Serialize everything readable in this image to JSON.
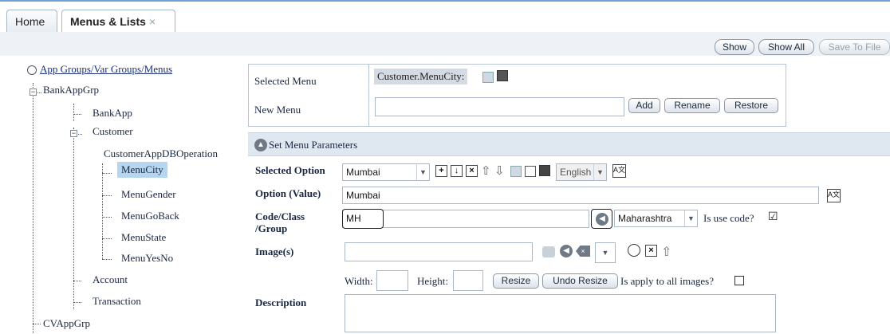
{
  "tabs": [
    {
      "label": "Home"
    },
    {
      "label": "Menus & Lists",
      "close": "×"
    }
  ],
  "toolbar": {
    "show": "Show",
    "show_all": "Show All",
    "save_to_file": "Save To File"
  },
  "tree": {
    "root": "App Groups/Var Groups/Menus",
    "bank_app_grp": "BankAppGrp",
    "bank_app": "BankApp",
    "customer": "Customer",
    "customer_db_op": "CustomerAppDBOperation",
    "menu_city": "MenuCity",
    "menu_gender": "MenuGender",
    "menu_go_back": "MenuGoBack",
    "menu_state": "MenuState",
    "menu_yes_no": "MenuYesNo",
    "account": "Account",
    "transaction": "Transaction",
    "cv_app_grp": "CVAppGrp"
  },
  "menu_box": {
    "selected_menu_label": "Selected Menu",
    "selected_menu_value": "Customer.MenuCity:",
    "new_menu_label": "New Menu",
    "new_menu_value": "",
    "add": "Add",
    "rename": "Rename",
    "restore": "Restore"
  },
  "params": {
    "header": "Set Menu Parameters",
    "selected_option_label": "Selected Option",
    "selected_option_value": "Mumbai",
    "language": "English",
    "option_value_label": "Option (Value)",
    "option_value": "Mumbai",
    "code_class_label_1": "Code/Class",
    "code_class_label_2": "/Group",
    "code_value": "MH",
    "group_value": "Maharashtra",
    "is_use_code": "Is use code?",
    "is_use_code_checked": "☑",
    "images_label": "Image(s)",
    "width_label": "Width:",
    "height_label": "Height:",
    "resize": "Resize",
    "undo_resize": "Undo Resize",
    "apply_all": "Is apply to all images?",
    "description_label": "Description"
  },
  "colors": {
    "accent": "#6ea0d4",
    "selection": "#b6d5ee",
    "header_bg": "#dfe7f0"
  }
}
